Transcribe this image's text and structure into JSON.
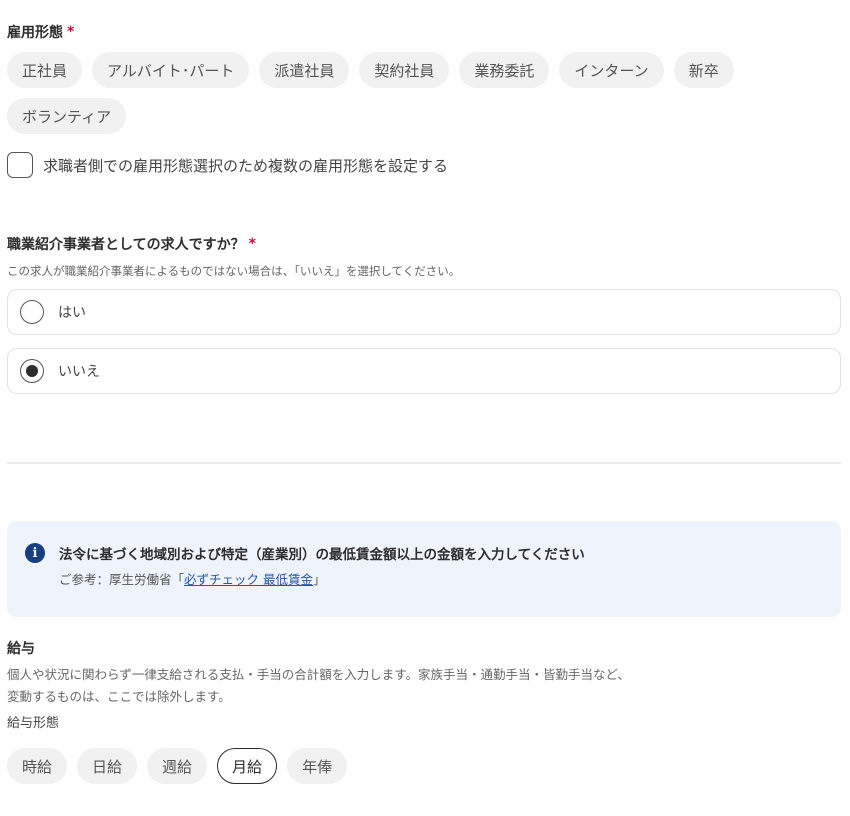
{
  "employment_type": {
    "label": "雇用形態",
    "required_mark": "*",
    "options": [
      "正社員",
      "アルバイト･パート",
      "派遣社員",
      "契約社員",
      "業務委託",
      "インターン",
      "新卒",
      "ボランティア"
    ],
    "multi_checkbox_label": "求職者側での雇用形態選択のため複数の雇用形態を設定する"
  },
  "agency_question": {
    "label": "職業紹介事業者としての求人ですか？",
    "required_mark": "*",
    "helper": "この求人が職業紹介事業者によるものではない場合は、「いいえ」を選択してください。",
    "options": [
      {
        "label": "はい",
        "selected": false
      },
      {
        "label": "いいえ",
        "selected": true
      }
    ]
  },
  "info_notice": {
    "icon": "info-icon",
    "title": "法令に基づく地域別および特定（産業別）の最低賃金額以上の金額を入力してください",
    "reference_prefix": "ご参考：厚生労働省「",
    "reference_link": "必ずチェック 最低賃金",
    "reference_suffix": "」"
  },
  "salary": {
    "label": "給与",
    "helper_line1": "個人や状況に関わらず一律支給される支払・手当の合計額を入力します。家族手当・通勤手当・皆勤手当など、",
    "helper_line2": "変動するものは、ここでは除外します。",
    "type_label": "給与形態",
    "type_options": [
      "時給",
      "日給",
      "週給",
      "月給",
      "年俸"
    ],
    "selected_type": "月給"
  }
}
